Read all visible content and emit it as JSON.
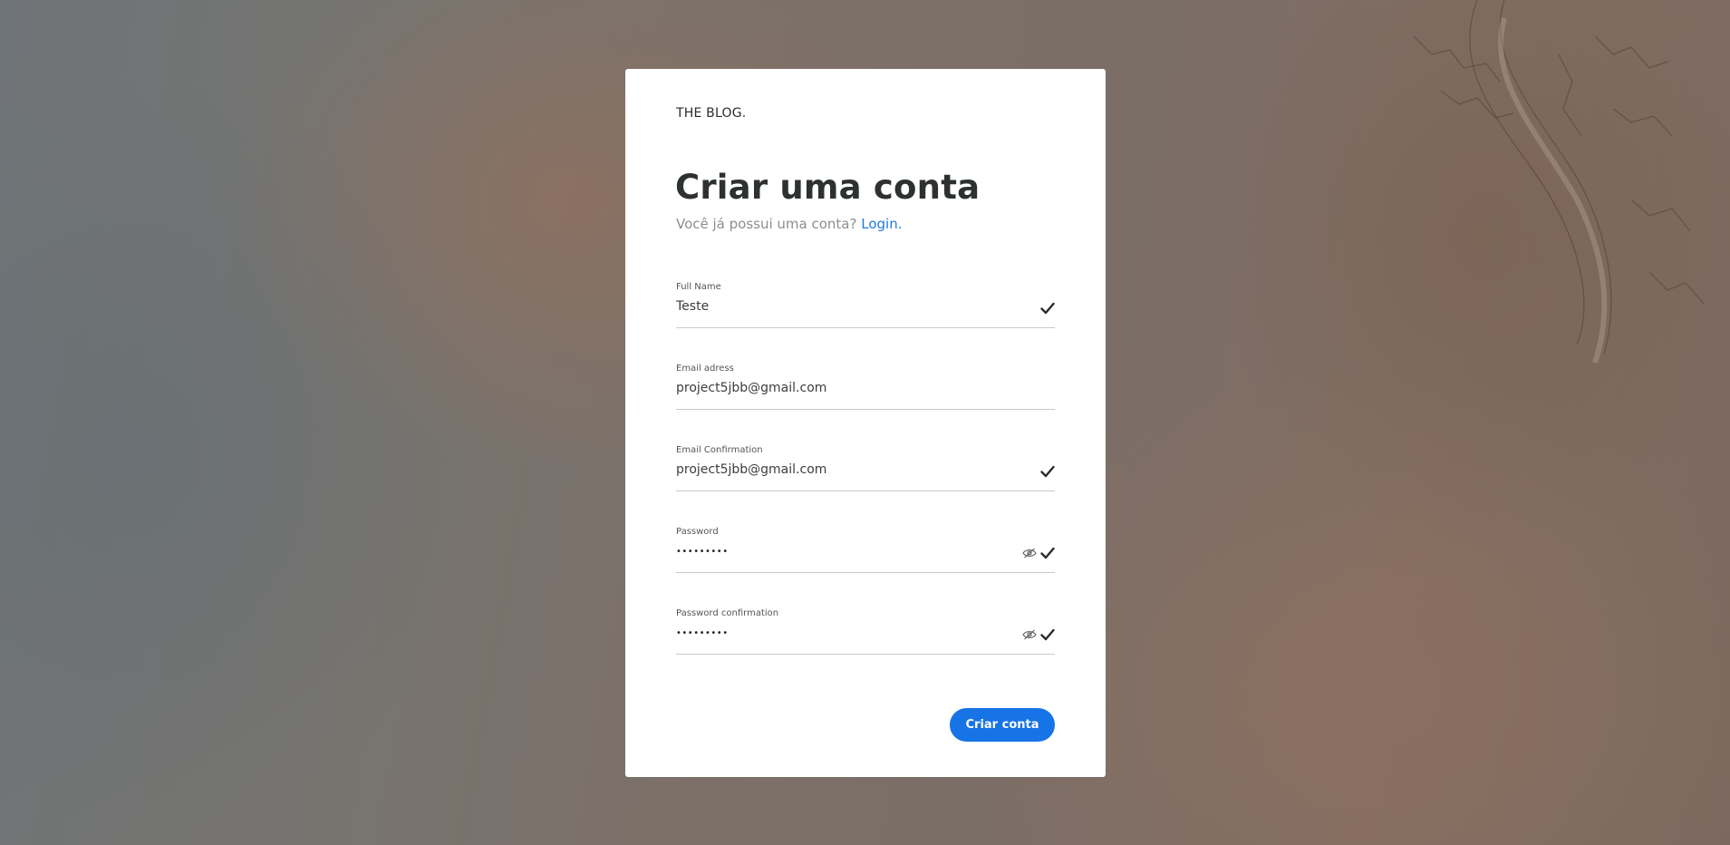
{
  "colors": {
    "accent": "#1774e6",
    "link": "#1f7ae0",
    "title": "#2e3132",
    "muted": "#8e8e8e"
  },
  "brand": "THE BLOG.",
  "heading": {
    "title": "Criar uma conta",
    "subtitle_text": "Você já possui uma conta?",
    "login_link": "Login."
  },
  "fields": [
    {
      "label": "Full Name",
      "value": "Teste",
      "icons": [
        "check-icon"
      ]
    },
    {
      "label": "Email adress",
      "value": "project5jbb@gmail.com",
      "icons": []
    },
    {
      "label": "Email Confirmation",
      "value": "project5jbb@gmail.com",
      "icons": [
        "check-icon"
      ]
    },
    {
      "label": "Password",
      "value": "•••••••••",
      "icons": [
        "eye-slash-icon",
        "check-icon"
      ]
    },
    {
      "label": "Password confirmation",
      "value": "•••••••••",
      "icons": [
        "eye-slash-icon",
        "check-icon"
      ]
    }
  ],
  "submit_label": "Criar conta"
}
